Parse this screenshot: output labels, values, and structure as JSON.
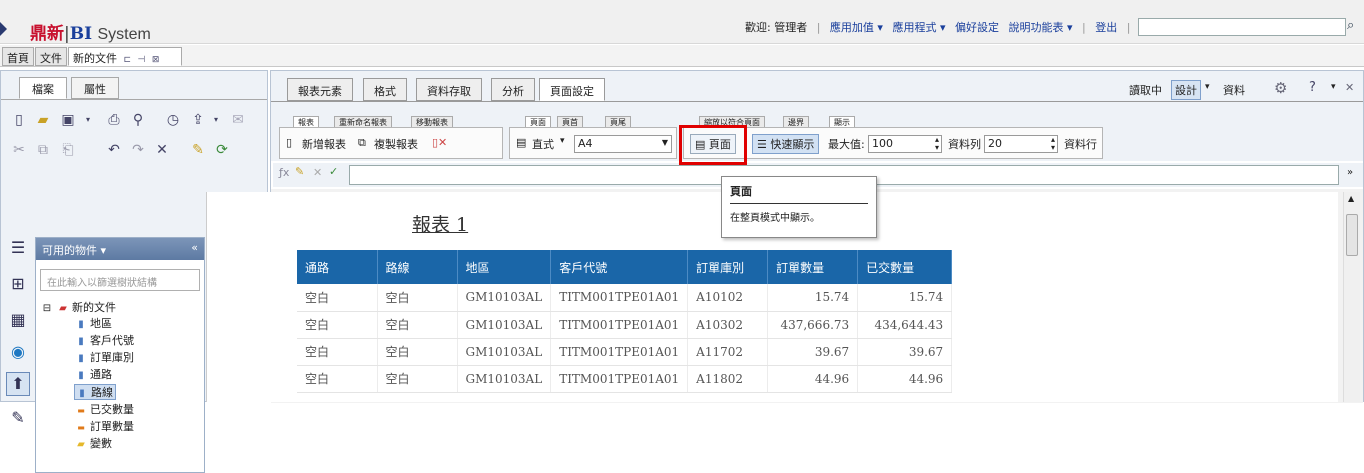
{
  "topbar": {
    "brand_cn": "鼎新",
    "brand_bi": "BI",
    "brand_sys": "System",
    "welcome": "歡迎: 管理者",
    "nav": [
      "應用加值 ▾",
      "應用程式 ▾",
      "偏好設定",
      "說明功能表 ▾"
    ],
    "logout": "登出",
    "search_value": ""
  },
  "doc_tabs": {
    "home": "首頁",
    "docs": "文件",
    "current": "新的文件"
  },
  "left": {
    "tabs": [
      "檔案",
      "屬性"
    ],
    "objects_header": "可用的物件 ▾",
    "filter_placeholder": "在此輸入以篩選樹狀結構",
    "tree_root": "新的文件",
    "tree_items": [
      "地區",
      "客戶代號",
      "訂單庫別",
      "通路",
      "路線",
      "已交數量",
      "訂單數量",
      "變數"
    ],
    "selected_item": "路線"
  },
  "ribbon": {
    "tabs": [
      "報表元素",
      "格式",
      "資料存取",
      "分析",
      "頁面設定"
    ],
    "active_tab": "頁面設定",
    "right_labels": {
      "read": "讀取中",
      "design": "設計",
      "data": "資料"
    },
    "subtabs_report": [
      "報表",
      "重新命名報表",
      "移動報表"
    ],
    "subtabs_page": [
      "頁面",
      "頁首",
      "頁尾"
    ],
    "subtabs_scale": [
      "縮放以符合頁面",
      "邊界",
      "顯示"
    ],
    "new_report": "新增報表",
    "copy_report": "複製報表",
    "orientation": "直式",
    "paper": "A4",
    "page_button": "頁面",
    "quick_display": "快速顯示",
    "max_label": "最大值:",
    "max_value": "100",
    "rows_label": "資料列",
    "rows_value": "20",
    "rows_label2": "資料行"
  },
  "tooltip": {
    "title": "頁面",
    "desc": "在整頁模式中顯示。"
  },
  "report": {
    "title": "報表 1",
    "headers": [
      "通路",
      "路線",
      "地區",
      "客戶代號",
      "訂單庫別",
      "訂單數量",
      "已交數量"
    ],
    "rows": [
      [
        "空白",
        "空白",
        "GM10103AL",
        "TITM001TPE01A01",
        "A10102",
        "15.74",
        "15.74"
      ],
      [
        "空白",
        "空白",
        "GM10103AL",
        "TITM001TPE01A01",
        "A10302",
        "437,666.73",
        "434,644.43"
      ],
      [
        "空白",
        "空白",
        "GM10103AL",
        "TITM001TPE01A01",
        "A11702",
        "39.67",
        "39.67"
      ],
      [
        "空白",
        "空白",
        "GM10103AL",
        "TITM001TPE01A01",
        "A11802",
        "44.96",
        "44.96"
      ]
    ]
  },
  "colors": {
    "accent": "#1a66a8",
    "highlight": "#e00000",
    "brand_red": "#c8102e"
  }
}
